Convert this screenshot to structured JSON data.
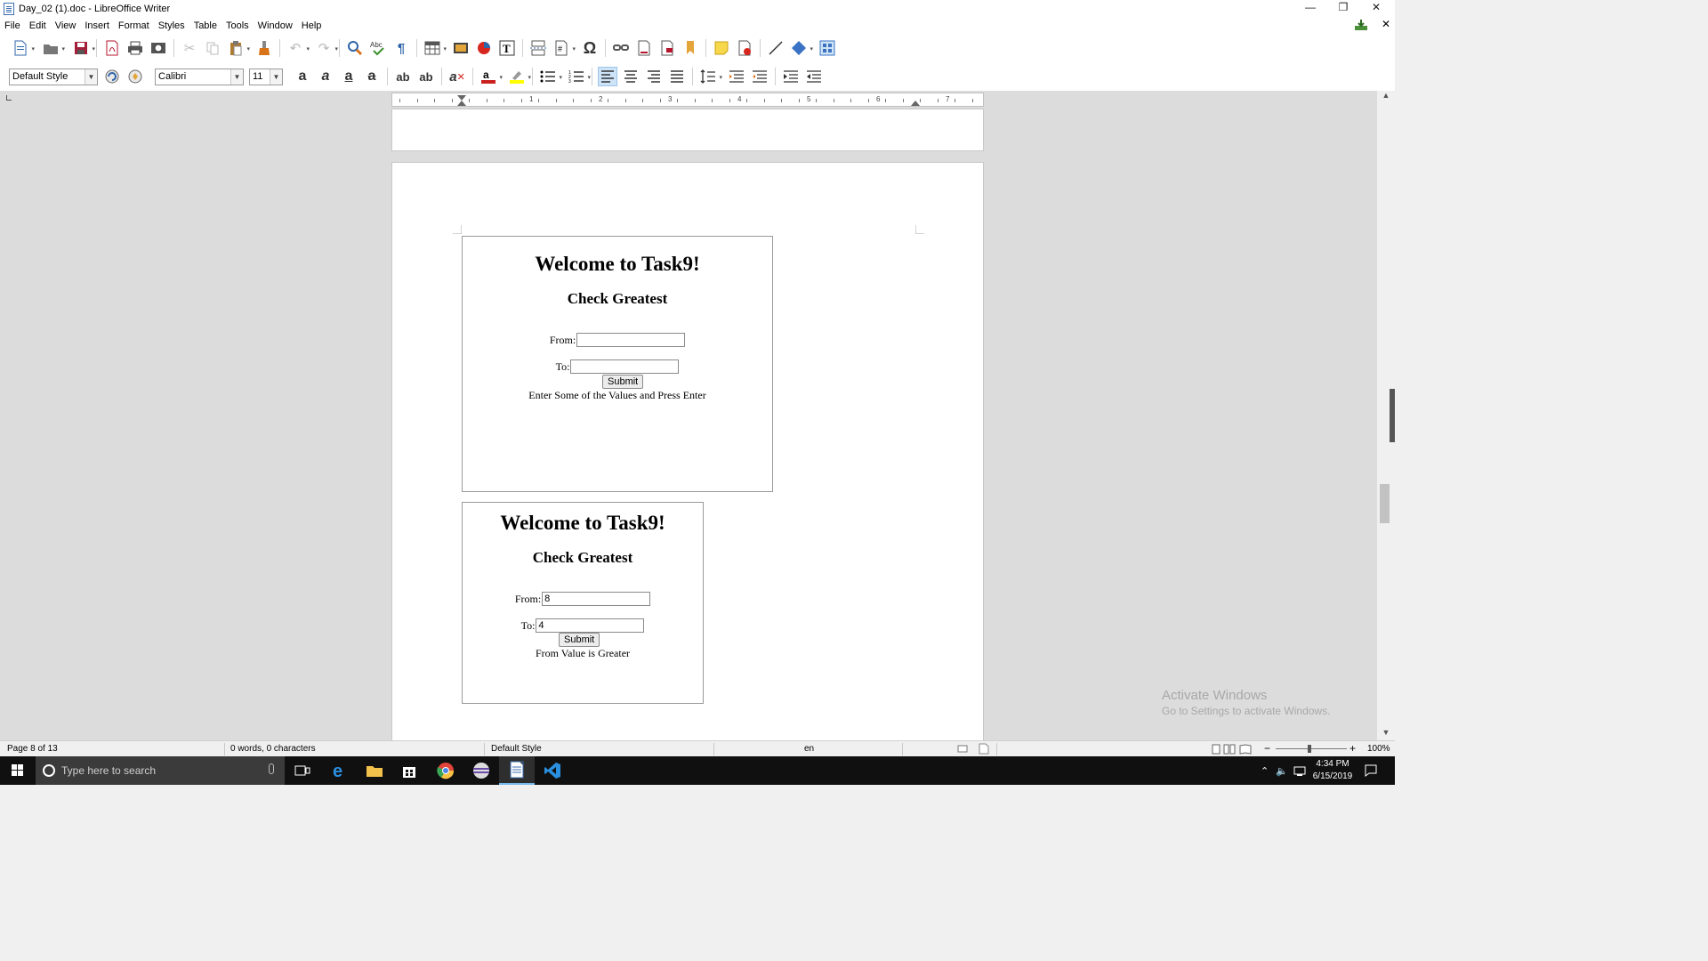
{
  "window": {
    "title": "Day_02 (1).doc - LibreOffice Writer",
    "controls": {
      "minimize": "—",
      "restore": "❐",
      "close": "✕"
    }
  },
  "menubar": {
    "items": [
      "File",
      "Edit",
      "View",
      "Insert",
      "Format",
      "Styles",
      "Table",
      "Tools",
      "Window",
      "Help"
    ],
    "close_doc": "✕"
  },
  "formatting": {
    "paragraph_style": "Default Style",
    "font_name": "Calibri",
    "font_size": "11"
  },
  "ruler": {
    "numbers": [
      "1",
      "2",
      "3",
      "4",
      "5",
      "6",
      "7"
    ]
  },
  "document": {
    "screenshot1": {
      "heading": "Welcome to Task9!",
      "subheading": "Check Greatest",
      "from_label": "From:",
      "from_value": "",
      "to_label": "To:",
      "to_value": "",
      "submit_label": "Submit",
      "message": "Enter Some of the Values and Press Enter"
    },
    "screenshot2": {
      "heading": "Welcome to Task9!",
      "subheading": "Check Greatest",
      "from_label": "From:",
      "from_value": "8",
      "to_label": "To:",
      "to_value": "4",
      "submit_label": "Submit",
      "message": "From Value is Greater"
    }
  },
  "watermark": {
    "line1": "Activate Windows",
    "line2": "Go to Settings to activate Windows."
  },
  "statusbar": {
    "page": "Page 8 of 13",
    "words": "0 words, 0 characters",
    "page_style": "Default Style",
    "language": "en",
    "zoom": "100%"
  },
  "taskbar": {
    "search_placeholder": "Type here to search",
    "time": "4:34 PM",
    "date": "6/15/2019"
  }
}
